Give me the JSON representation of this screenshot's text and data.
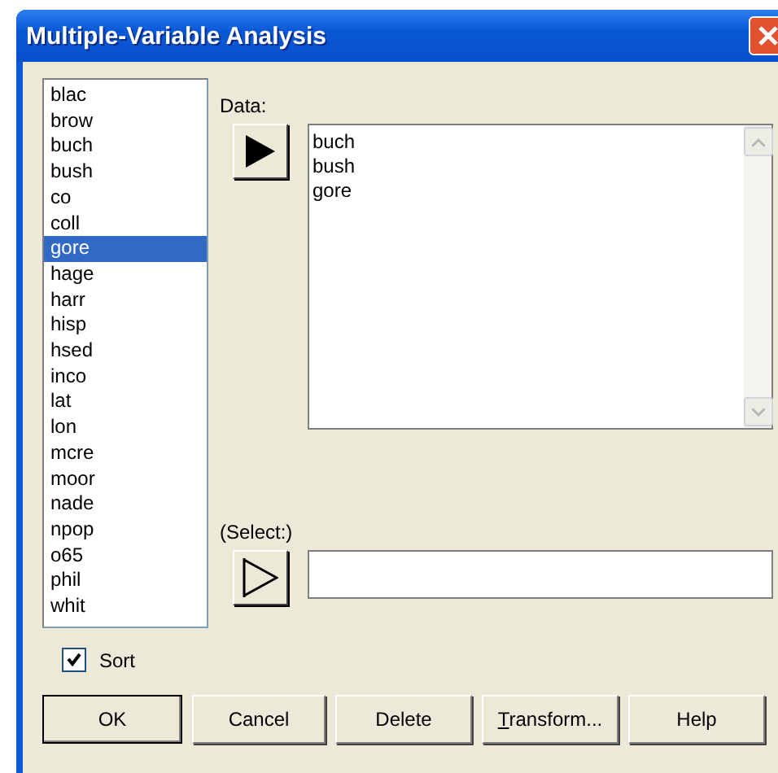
{
  "window": {
    "title": "Multiple-Variable Analysis"
  },
  "variables": [
    {
      "label": "blac",
      "selected": false
    },
    {
      "label": "brow",
      "selected": false
    },
    {
      "label": "buch",
      "selected": false
    },
    {
      "label": "bush",
      "selected": false
    },
    {
      "label": "co",
      "selected": false
    },
    {
      "label": "coll",
      "selected": false
    },
    {
      "label": "gore",
      "selected": true
    },
    {
      "label": "hage",
      "selected": false
    },
    {
      "label": "harr",
      "selected": false
    },
    {
      "label": "hisp",
      "selected": false
    },
    {
      "label": "hsed",
      "selected": false
    },
    {
      "label": "inco",
      "selected": false
    },
    {
      "label": "lat",
      "selected": false
    },
    {
      "label": "lon",
      "selected": false
    },
    {
      "label": "mcre",
      "selected": false
    },
    {
      "label": "moor",
      "selected": false
    },
    {
      "label": "nade",
      "selected": false
    },
    {
      "label": "npop",
      "selected": false
    },
    {
      "label": "o65",
      "selected": false
    },
    {
      "label": "phil",
      "selected": false
    },
    {
      "label": "whit",
      "selected": false
    }
  ],
  "data": {
    "label": "Data:",
    "items": [
      "buch",
      "bush",
      "gore"
    ]
  },
  "select": {
    "label": "(Select:)"
  },
  "sort": {
    "label": "Sort",
    "checked": true
  },
  "buttons": [
    {
      "label": "OK",
      "default": true
    },
    {
      "label": "Cancel",
      "default": false
    },
    {
      "label": "Delete",
      "default": false
    },
    {
      "label": "Transform...",
      "default": false
    },
    {
      "label": "Help",
      "default": false
    }
  ]
}
